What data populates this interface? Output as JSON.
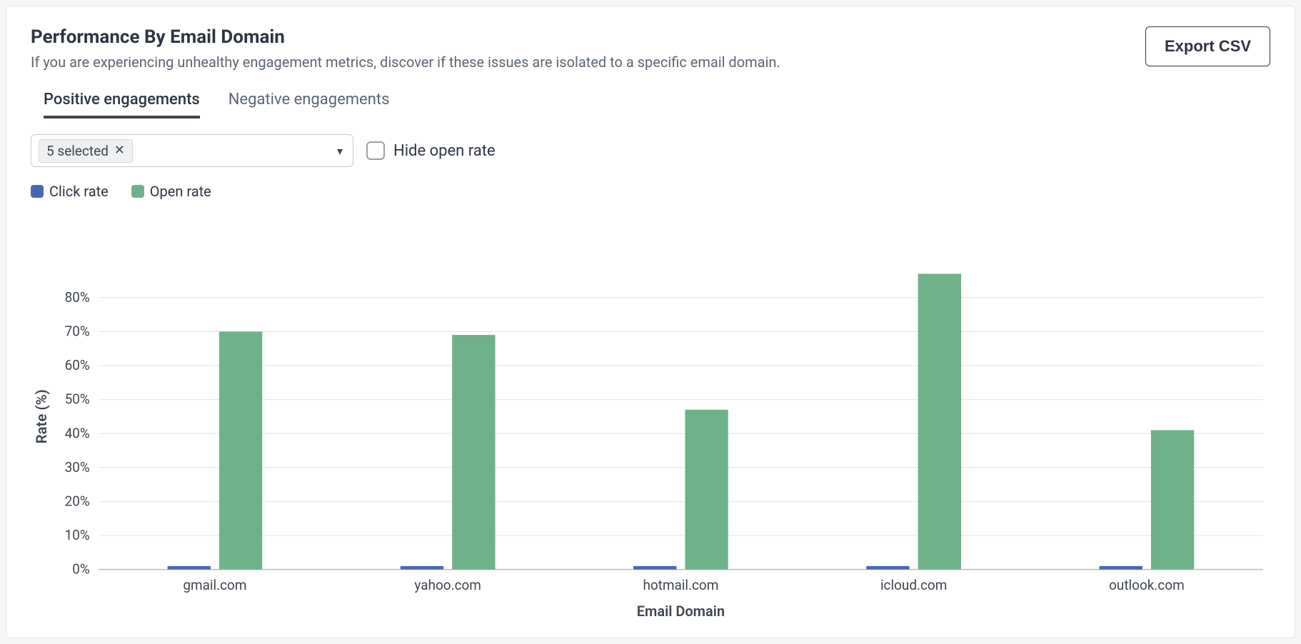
{
  "header": {
    "title": "Performance By Email Domain",
    "subtitle": "If you are experiencing unhealthy engagement metrics, discover if these issues are isolated to a specific email domain.",
    "export_label": "Export CSV"
  },
  "tabs": {
    "positive": "Positive engagements",
    "negative": "Negative engagements"
  },
  "controls": {
    "selected_chip": "5 selected",
    "hide_open_label": "Hide open rate"
  },
  "legend": {
    "click": "Click rate",
    "open": "Open rate"
  },
  "colors": {
    "click": "#4767b6",
    "open": "#6fb28a"
  },
  "chart_data": {
    "type": "bar",
    "title": "",
    "xlabel": "Email Domain",
    "ylabel": "Rate (%)",
    "ylim": [
      0,
      90
    ],
    "yticks": [
      0,
      10,
      20,
      30,
      40,
      50,
      60,
      70,
      80
    ],
    "ytick_labels": [
      "0%",
      "10%",
      "20%",
      "30%",
      "40%",
      "50%",
      "60%",
      "70%",
      "80%"
    ],
    "categories": [
      "gmail.com",
      "yahoo.com",
      "hotmail.com",
      "icloud.com",
      "outlook.com"
    ],
    "series": [
      {
        "name": "Click rate",
        "values": [
          1,
          1,
          1,
          1,
          1
        ]
      },
      {
        "name": "Open rate",
        "values": [
          70,
          69,
          47,
          87,
          41
        ]
      }
    ]
  }
}
